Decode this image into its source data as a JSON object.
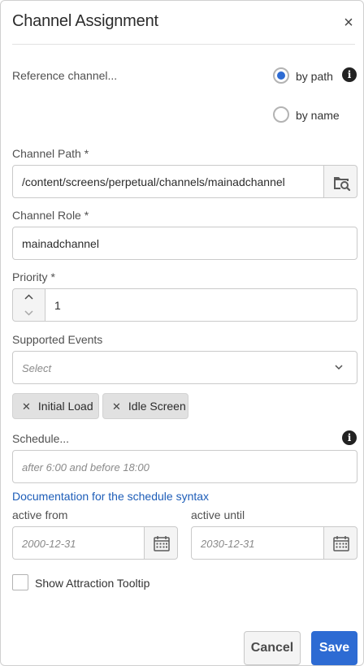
{
  "dialog": {
    "title": "Channel Assignment",
    "close_glyph": "×"
  },
  "reference": {
    "label": "Reference channel...",
    "options": [
      {
        "label": "by path",
        "selected": true
      },
      {
        "label": "by name",
        "selected": false
      }
    ],
    "info_glyph": "i"
  },
  "channel_path": {
    "label": "Channel Path *",
    "value": "/content/screens/perpetual/channels/mainadchannel"
  },
  "channel_role": {
    "label": "Channel Role *",
    "value": "mainadchannel"
  },
  "priority": {
    "label": "Priority *",
    "value": "1"
  },
  "supported_events": {
    "label": "Supported Events",
    "placeholder": "Select",
    "tags": [
      "Initial Load",
      "Idle Screen"
    ],
    "tag_remove_glyph": "✕"
  },
  "schedule": {
    "label": "Schedule...",
    "placeholder": "after 6:00 and before 18:00",
    "info_glyph": "i",
    "doc_link": "Documentation for the schedule syntax"
  },
  "active_from": {
    "label": "active from",
    "placeholder": "2000-12-31"
  },
  "active_until": {
    "label": "active until",
    "placeholder": "2030-12-31"
  },
  "attraction_tooltip": {
    "label": "Show Attraction Tooltip",
    "checked": false
  },
  "footer": {
    "cancel_label": "Cancel",
    "save_label": "Save"
  },
  "colors": {
    "accent": "#2d6bd3",
    "link": "#1d5db8"
  }
}
